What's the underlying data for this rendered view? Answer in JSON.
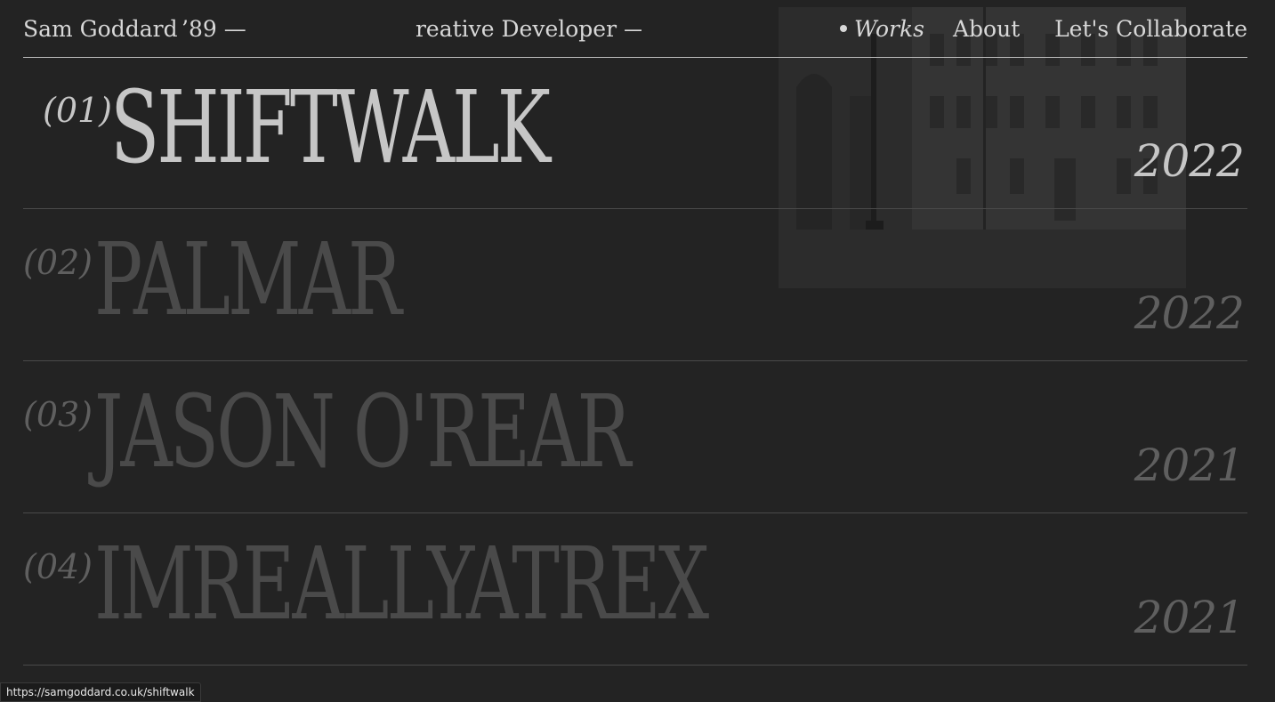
{
  "header": {
    "brand": "Sam Goddard",
    "year": "’89 —",
    "ticker": "’reative Developer  —  Av",
    "nav": {
      "works": "Works",
      "about": "About",
      "collaborate": "Let's Collaborate"
    }
  },
  "works": [
    {
      "num": "(01)",
      "title": "SHIFTWALK",
      "year": "2022"
    },
    {
      "num": "(02)",
      "title": "PALMAR",
      "year": "2022"
    },
    {
      "num": "(03)",
      "title": "JASON O'REAR",
      "year": "2021"
    },
    {
      "num": "(04)",
      "title": "IMREALLYATREX",
      "year": "2021"
    }
  ],
  "status_url": "https://samgoddard.co.uk/shiftwalk",
  "colors": {
    "background": "#232323",
    "active_text": "#c6c6c6",
    "inactive_text": "#4a4a4a"
  }
}
